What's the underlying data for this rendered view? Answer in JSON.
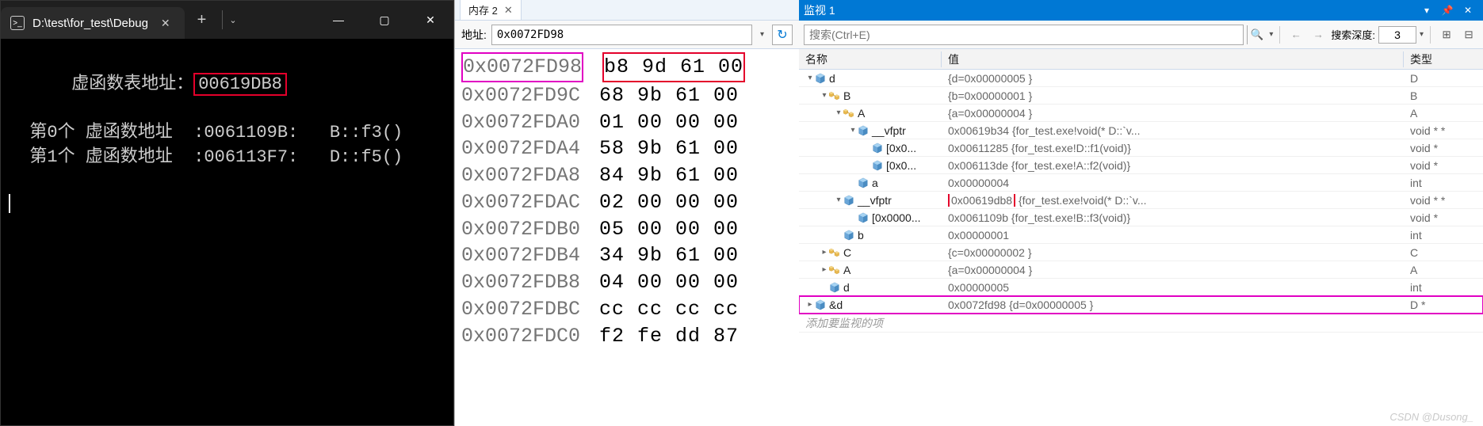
{
  "console": {
    "tab_title": "D:\\test\\for_test\\Debug",
    "line1_label": "虚函数表地址：",
    "line1_value": "00619DB8",
    "line2": "  第0个 虚函数地址  :0061109B:   B::f3()",
    "line3": "  第1个 虚函数地址  :006113F7:   D::f5()"
  },
  "memory": {
    "tab_label": "内存 2",
    "addr_label": "地址:",
    "addr_value": "0x0072FD98",
    "rows": [
      {
        "addr": "0x0072FD98",
        "bytes": "b8 9d 61 00"
      },
      {
        "addr": "0x0072FD9C",
        "bytes": "68 9b 61 00"
      },
      {
        "addr": "0x0072FDA0",
        "bytes": "01 00 00 00"
      },
      {
        "addr": "0x0072FDA4",
        "bytes": "58 9b 61 00"
      },
      {
        "addr": "0x0072FDA8",
        "bytes": "84 9b 61 00"
      },
      {
        "addr": "0x0072FDAC",
        "bytes": "02 00 00 00"
      },
      {
        "addr": "0x0072FDB0",
        "bytes": "05 00 00 00"
      },
      {
        "addr": "0x0072FDB4",
        "bytes": "34 9b 61 00"
      },
      {
        "addr": "0x0072FDB8",
        "bytes": "04 00 00 00"
      },
      {
        "addr": "0x0072FDBC",
        "bytes": "cc cc cc cc"
      },
      {
        "addr": "0x0072FDC0",
        "bytes": "f2 fe dd 87"
      }
    ]
  },
  "watch": {
    "title": "监视 1",
    "search_placeholder": "搜索(Ctrl+E)",
    "depth_label": "搜索深度:",
    "depth_value": "3",
    "col_name": "名称",
    "col_value": "值",
    "col_type": "类型",
    "add_label": "添加要监视的项",
    "rows": [
      {
        "indent": 0,
        "exp": "▾",
        "icon": "cube",
        "name": "d",
        "value": "{d=0x00000005 }",
        "type": "D"
      },
      {
        "indent": 1,
        "exp": "▾",
        "icon": "class",
        "name": "B",
        "value": "{b=0x00000001 }",
        "type": "B"
      },
      {
        "indent": 2,
        "exp": "▾",
        "icon": "class",
        "name": "A",
        "value": "{a=0x00000004 }",
        "type": "A"
      },
      {
        "indent": 3,
        "exp": "▾",
        "icon": "cube",
        "name": "__vfptr",
        "value": "0x00619b34 {for_test.exe!void(* D::`v...",
        "type": "void * *"
      },
      {
        "indent": 4,
        "exp": "",
        "icon": "cube",
        "name": "[0x0...",
        "value": "0x00611285 {for_test.exe!D::f1(void)}",
        "type": "void *"
      },
      {
        "indent": 4,
        "exp": "",
        "icon": "cube",
        "name": "[0x0...",
        "value": "0x006113de {for_test.exe!A::f2(void)}",
        "type": "void *"
      },
      {
        "indent": 3,
        "exp": "",
        "icon": "cube",
        "name": "a",
        "value": "0x00000004",
        "type": "int"
      },
      {
        "indent": 2,
        "exp": "▾",
        "icon": "cube",
        "name": "__vfptr",
        "value_pre": "",
        "value_hl": "0x00619db8",
        "value_post": " {for_test.exe!void(* D::`v...",
        "type": "void * *",
        "hl": "red"
      },
      {
        "indent": 3,
        "exp": "",
        "icon": "cube",
        "name": "[0x0000...",
        "value": "0x0061109b {for_test.exe!B::f3(void)}",
        "type": "void *"
      },
      {
        "indent": 2,
        "exp": "",
        "icon": "cube",
        "name": "b",
        "value": "0x00000001",
        "type": "int"
      },
      {
        "indent": 1,
        "exp": "▸",
        "icon": "class",
        "name": "C",
        "value": "{c=0x00000002 }",
        "type": "C"
      },
      {
        "indent": 1,
        "exp": "▸",
        "icon": "class",
        "name": "A",
        "value": "{a=0x00000004 }",
        "type": "A"
      },
      {
        "indent": 1,
        "exp": "",
        "icon": "cube",
        "name": "d",
        "value": "0x00000005",
        "type": "int"
      },
      {
        "indent": 0,
        "exp": "▸",
        "icon": "cube",
        "name": "&d",
        "value": "0x0072fd98 {d=0x00000005 }",
        "type": "D *",
        "row_hl": "magenta"
      }
    ]
  },
  "watermark": "CSDN @Dusong_"
}
